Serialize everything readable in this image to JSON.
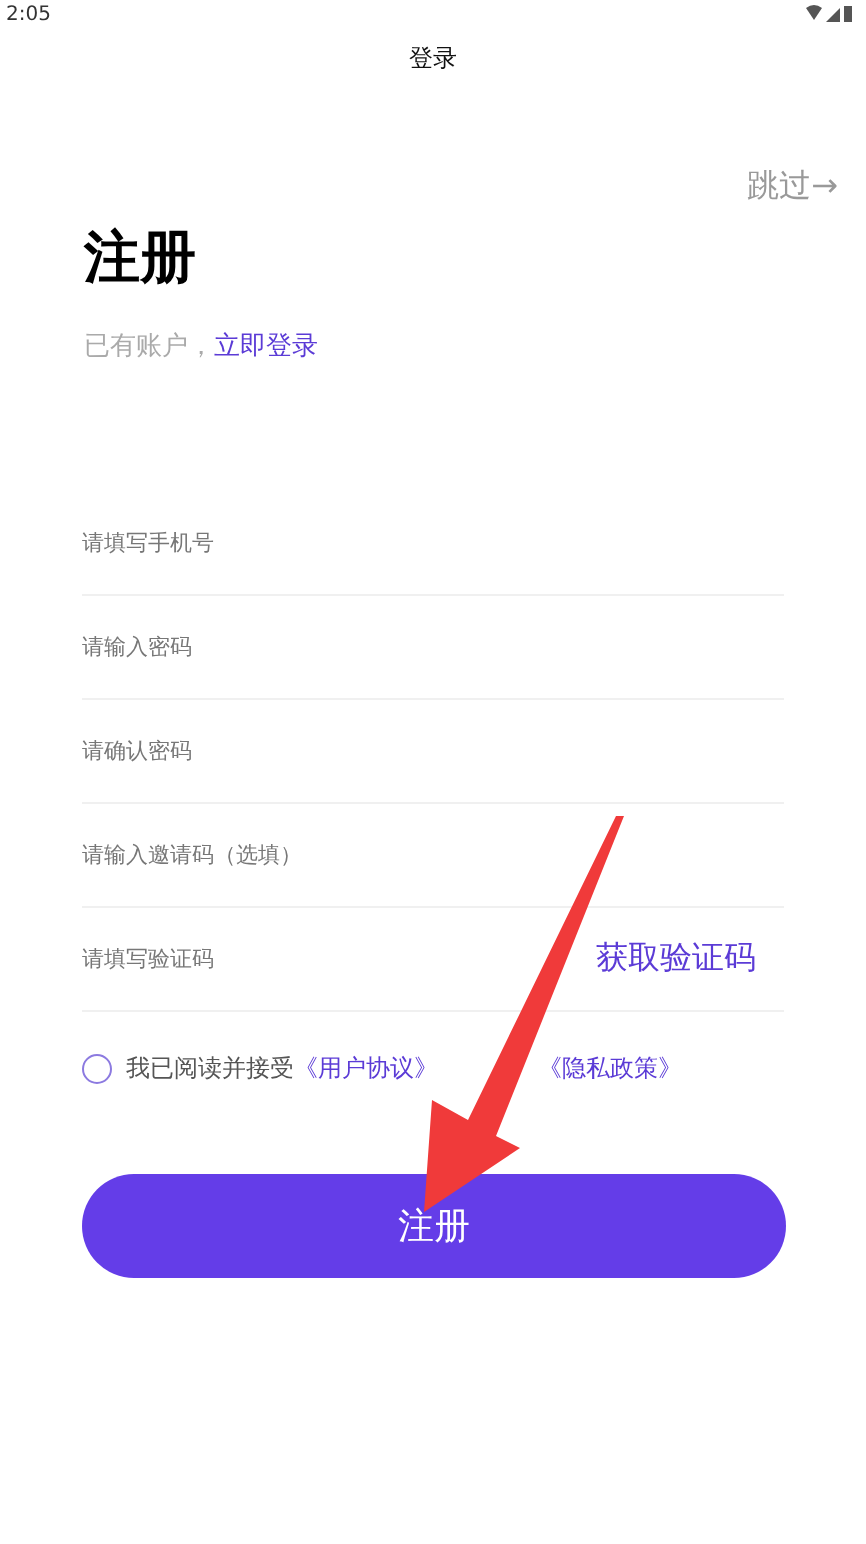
{
  "status_bar": {
    "time": "2:05"
  },
  "header": {
    "title": "登录"
  },
  "skip": {
    "label": "跳过→"
  },
  "heading": "注册",
  "login_prompt": {
    "text": "已有账户，",
    "link": "立即登录"
  },
  "fields": [
    {
      "placeholder": "请填写手机号"
    },
    {
      "placeholder": "请输入密码"
    },
    {
      "placeholder": "请确认密码"
    },
    {
      "placeholder": "请输入邀请码（选填）"
    },
    {
      "placeholder": "请填写验证码",
      "action": "获取验证码"
    }
  ],
  "agreement": {
    "checked": false,
    "text": "我已阅读并接受",
    "link_1": "《用户协议》",
    "link_2": "《隐私政策》"
  },
  "submit": {
    "label": "注册"
  }
}
